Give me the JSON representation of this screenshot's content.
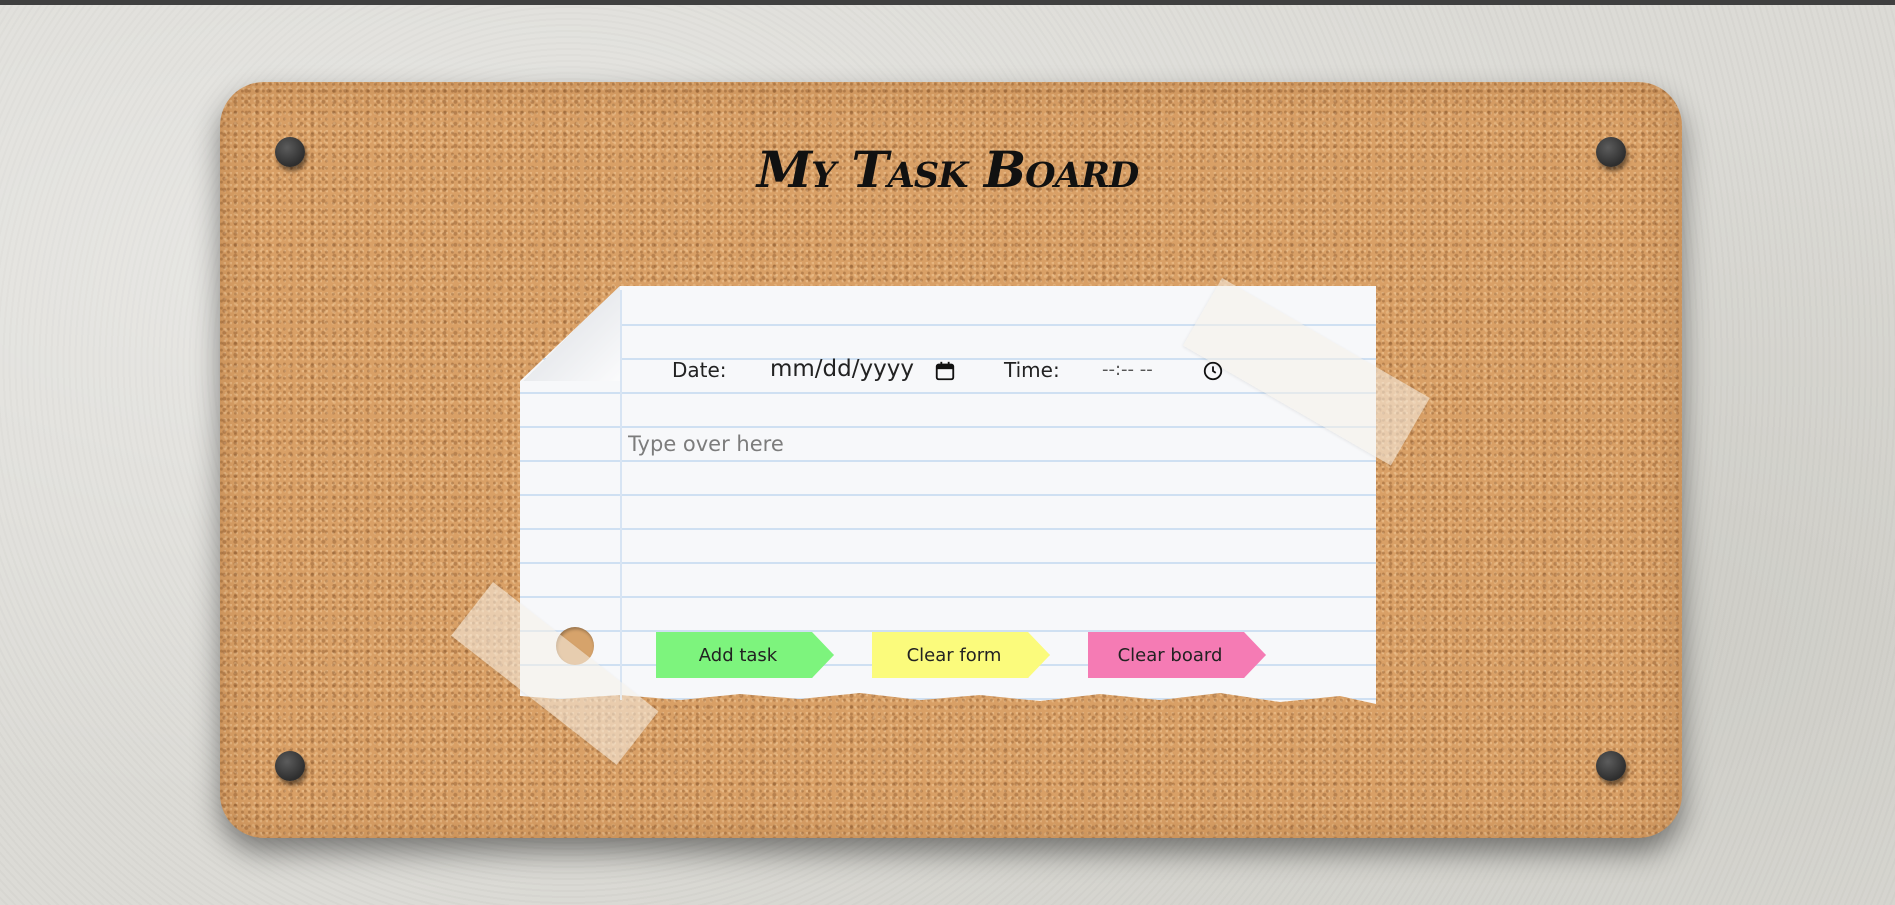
{
  "board": {
    "title": "My Task Board"
  },
  "form": {
    "date_label": "Date:",
    "date_value": "mm/dd/yyyy",
    "time_label": "Time:",
    "time_value": "--:-- --",
    "task_placeholder": "Type over here"
  },
  "buttons": {
    "add_task": "Add task",
    "clear_form": "Clear form",
    "clear_board": "Clear board"
  },
  "colors": {
    "add_task": "#7df47d",
    "clear_form": "#fbfb7c",
    "clear_board": "#f57bb4",
    "cork": "#d9a066"
  },
  "icons": {
    "date_picker": "calendar-icon",
    "time_picker": "clock-icon"
  }
}
